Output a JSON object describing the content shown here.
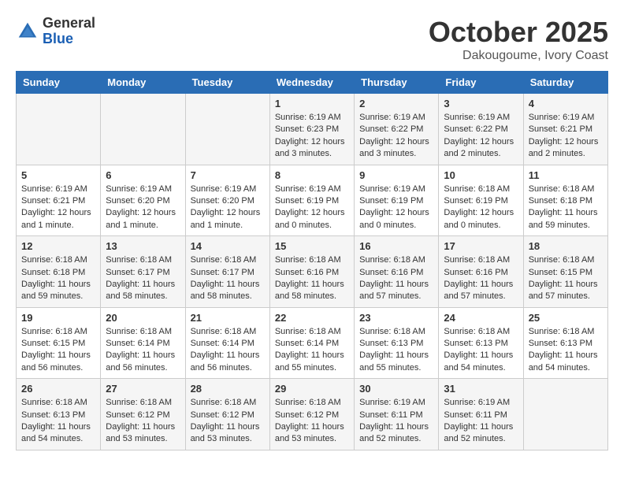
{
  "logo": {
    "general": "General",
    "blue": "Blue"
  },
  "header": {
    "month": "October 2025",
    "location": "Dakougoume, Ivory Coast"
  },
  "weekdays": [
    "Sunday",
    "Monday",
    "Tuesday",
    "Wednesday",
    "Thursday",
    "Friday",
    "Saturday"
  ],
  "weeks": [
    [
      {
        "day": "",
        "info": ""
      },
      {
        "day": "",
        "info": ""
      },
      {
        "day": "",
        "info": ""
      },
      {
        "day": "1",
        "info": "Sunrise: 6:19 AM\nSunset: 6:23 PM\nDaylight: 12 hours and 3 minutes."
      },
      {
        "day": "2",
        "info": "Sunrise: 6:19 AM\nSunset: 6:22 PM\nDaylight: 12 hours and 3 minutes."
      },
      {
        "day": "3",
        "info": "Sunrise: 6:19 AM\nSunset: 6:22 PM\nDaylight: 12 hours and 2 minutes."
      },
      {
        "day": "4",
        "info": "Sunrise: 6:19 AM\nSunset: 6:21 PM\nDaylight: 12 hours and 2 minutes."
      }
    ],
    [
      {
        "day": "5",
        "info": "Sunrise: 6:19 AM\nSunset: 6:21 PM\nDaylight: 12 hours and 1 minute."
      },
      {
        "day": "6",
        "info": "Sunrise: 6:19 AM\nSunset: 6:20 PM\nDaylight: 12 hours and 1 minute."
      },
      {
        "day": "7",
        "info": "Sunrise: 6:19 AM\nSunset: 6:20 PM\nDaylight: 12 hours and 1 minute."
      },
      {
        "day": "8",
        "info": "Sunrise: 6:19 AM\nSunset: 6:19 PM\nDaylight: 12 hours and 0 minutes."
      },
      {
        "day": "9",
        "info": "Sunrise: 6:19 AM\nSunset: 6:19 PM\nDaylight: 12 hours and 0 minutes."
      },
      {
        "day": "10",
        "info": "Sunrise: 6:18 AM\nSunset: 6:19 PM\nDaylight: 12 hours and 0 minutes."
      },
      {
        "day": "11",
        "info": "Sunrise: 6:18 AM\nSunset: 6:18 PM\nDaylight: 11 hours and 59 minutes."
      }
    ],
    [
      {
        "day": "12",
        "info": "Sunrise: 6:18 AM\nSunset: 6:18 PM\nDaylight: 11 hours and 59 minutes."
      },
      {
        "day": "13",
        "info": "Sunrise: 6:18 AM\nSunset: 6:17 PM\nDaylight: 11 hours and 58 minutes."
      },
      {
        "day": "14",
        "info": "Sunrise: 6:18 AM\nSunset: 6:17 PM\nDaylight: 11 hours and 58 minutes."
      },
      {
        "day": "15",
        "info": "Sunrise: 6:18 AM\nSunset: 6:16 PM\nDaylight: 11 hours and 58 minutes."
      },
      {
        "day": "16",
        "info": "Sunrise: 6:18 AM\nSunset: 6:16 PM\nDaylight: 11 hours and 57 minutes."
      },
      {
        "day": "17",
        "info": "Sunrise: 6:18 AM\nSunset: 6:16 PM\nDaylight: 11 hours and 57 minutes."
      },
      {
        "day": "18",
        "info": "Sunrise: 6:18 AM\nSunset: 6:15 PM\nDaylight: 11 hours and 57 minutes."
      }
    ],
    [
      {
        "day": "19",
        "info": "Sunrise: 6:18 AM\nSunset: 6:15 PM\nDaylight: 11 hours and 56 minutes."
      },
      {
        "day": "20",
        "info": "Sunrise: 6:18 AM\nSunset: 6:14 PM\nDaylight: 11 hours and 56 minutes."
      },
      {
        "day": "21",
        "info": "Sunrise: 6:18 AM\nSunset: 6:14 PM\nDaylight: 11 hours and 56 minutes."
      },
      {
        "day": "22",
        "info": "Sunrise: 6:18 AM\nSunset: 6:14 PM\nDaylight: 11 hours and 55 minutes."
      },
      {
        "day": "23",
        "info": "Sunrise: 6:18 AM\nSunset: 6:13 PM\nDaylight: 11 hours and 55 minutes."
      },
      {
        "day": "24",
        "info": "Sunrise: 6:18 AM\nSunset: 6:13 PM\nDaylight: 11 hours and 54 minutes."
      },
      {
        "day": "25",
        "info": "Sunrise: 6:18 AM\nSunset: 6:13 PM\nDaylight: 11 hours and 54 minutes."
      }
    ],
    [
      {
        "day": "26",
        "info": "Sunrise: 6:18 AM\nSunset: 6:13 PM\nDaylight: 11 hours and 54 minutes."
      },
      {
        "day": "27",
        "info": "Sunrise: 6:18 AM\nSunset: 6:12 PM\nDaylight: 11 hours and 53 minutes."
      },
      {
        "day": "28",
        "info": "Sunrise: 6:18 AM\nSunset: 6:12 PM\nDaylight: 11 hours and 53 minutes."
      },
      {
        "day": "29",
        "info": "Sunrise: 6:18 AM\nSunset: 6:12 PM\nDaylight: 11 hours and 53 minutes."
      },
      {
        "day": "30",
        "info": "Sunrise: 6:19 AM\nSunset: 6:11 PM\nDaylight: 11 hours and 52 minutes."
      },
      {
        "day": "31",
        "info": "Sunrise: 6:19 AM\nSunset: 6:11 PM\nDaylight: 11 hours and 52 minutes."
      },
      {
        "day": "",
        "info": ""
      }
    ]
  ]
}
